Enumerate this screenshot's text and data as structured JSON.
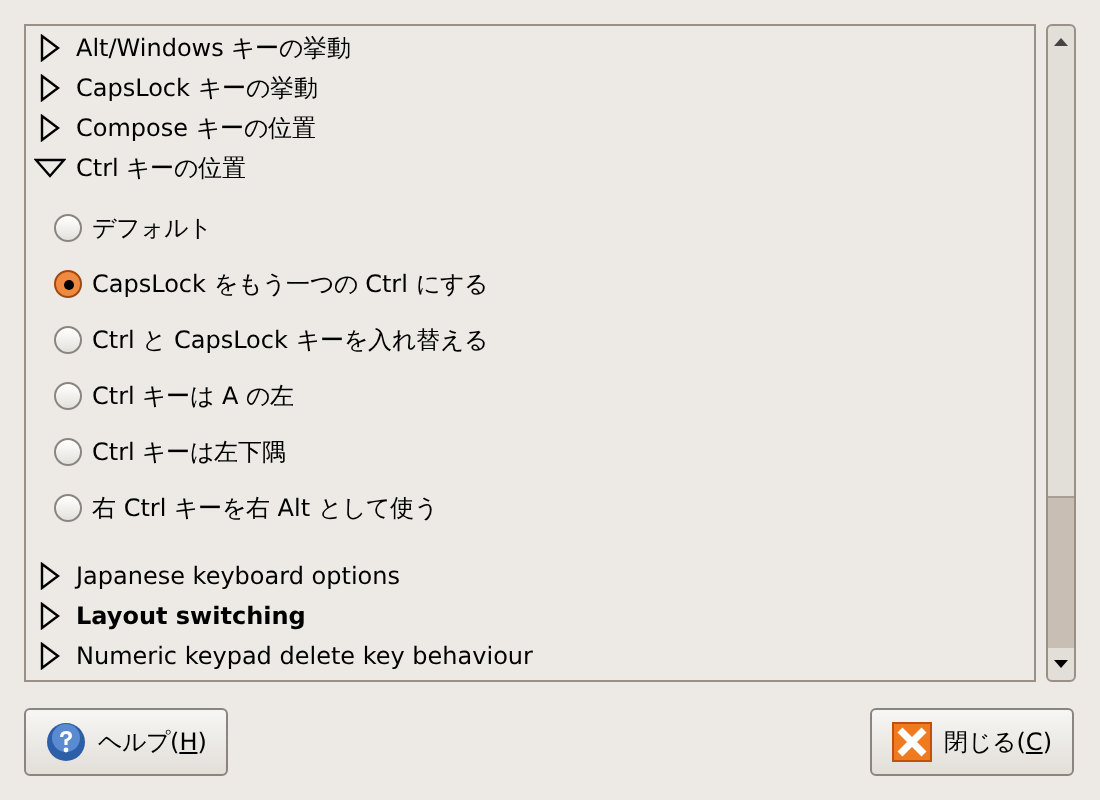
{
  "options": [
    {
      "label": "Alt/Windows キーの挙動",
      "expanded": false,
      "bold": false
    },
    {
      "label": "CapsLock キーの挙動",
      "expanded": false,
      "bold": false
    },
    {
      "label": "Compose キーの位置",
      "expanded": false,
      "bold": false
    },
    {
      "label": "Ctrl キーの位置",
      "expanded": true,
      "bold": false,
      "children": [
        {
          "label": "デフォルト",
          "selected": false
        },
        {
          "label": "CapsLock をもう一つの Ctrl にする",
          "selected": true
        },
        {
          "label": "Ctrl と CapsLock キーを入れ替える",
          "selected": false
        },
        {
          "label": "Ctrl キーは A の左",
          "selected": false
        },
        {
          "label": "Ctrl キーは左下隅",
          "selected": false
        },
        {
          "label": "右 Ctrl キーを右 Alt として使う",
          "selected": false
        }
      ]
    },
    {
      "label": "Japanese keyboard options",
      "expanded": false,
      "bold": false
    },
    {
      "label": "Layout switching",
      "expanded": false,
      "bold": true
    },
    {
      "label": "Numeric keypad delete key behaviour",
      "expanded": false,
      "bold": false
    }
  ],
  "buttons": [
    {
      "kind": "help",
      "label": "ヘルプ(",
      "accesskey": "H",
      "label_end": ")"
    },
    {
      "kind": "close",
      "label": "閉じる(",
      "accesskey": "C",
      "label_end": ")"
    }
  ]
}
